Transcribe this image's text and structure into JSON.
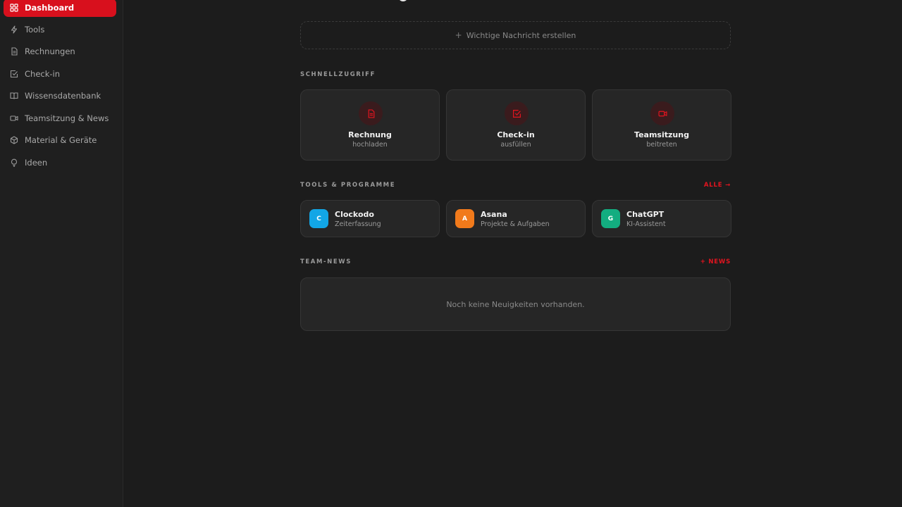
{
  "sidebar": {
    "items": [
      {
        "label": "Dashboard",
        "icon": "dashboard-icon",
        "active": true
      },
      {
        "label": "Tools",
        "icon": "lightning-icon"
      },
      {
        "label": "Rechnungen",
        "icon": "document-icon"
      },
      {
        "label": "Check-in",
        "icon": "checkbox-icon"
      },
      {
        "label": "Wissensdatenbank",
        "icon": "book-icon"
      },
      {
        "label": "Teamsitzung & News",
        "icon": "video-icon"
      },
      {
        "label": "Material & Geräte",
        "icon": "package-icon"
      },
      {
        "label": "Ideen",
        "icon": "lightbulb-icon"
      }
    ]
  },
  "important": {
    "plus": "+",
    "label": "Wichtige Nachricht erstellen"
  },
  "quick_access": {
    "label": "SCHNELLZUGRIFF",
    "cards": [
      {
        "title": "Rechnung",
        "subtitle": "hochladen",
        "icon": "document-icon"
      },
      {
        "title": "Check-in",
        "subtitle": "ausfüllen",
        "icon": "checkbox-icon"
      },
      {
        "title": "Teamsitzung",
        "subtitle": "beitreten",
        "icon": "video-icon"
      }
    ]
  },
  "tools": {
    "label": "TOOLS & PROGRAMME",
    "link": "ALLE →",
    "items": [
      {
        "letter": "C",
        "name": "Clockodo",
        "desc": "Zeiterfassung",
        "color": "#12a6e6"
      },
      {
        "letter": "A",
        "name": "Asana",
        "desc": "Projekte & Aufgaben",
        "color": "#f17a1b"
      },
      {
        "letter": "G",
        "name": "ChatGPT",
        "desc": "KI-Assistent",
        "color": "#13ad80"
      }
    ]
  },
  "news": {
    "label": "TEAM-NEWS",
    "link": "+ NEWS",
    "empty": "Noch keine Neuigkeiten vorhanden."
  },
  "colors": {
    "accent": "#d8101d",
    "accent_text": "#e3141f",
    "background": "#1c1c1c",
    "card": "#262626"
  }
}
